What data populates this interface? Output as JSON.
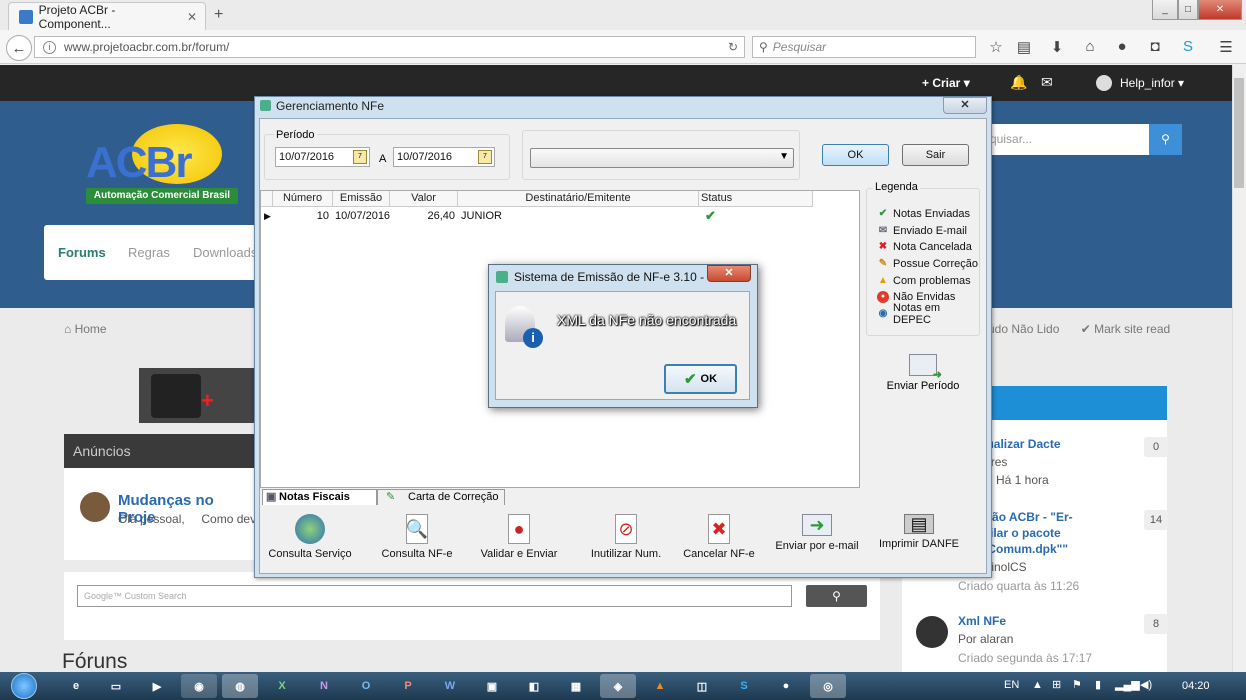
{
  "browser": {
    "tab_title": "Projeto ACBr - Component...",
    "new_tab": "+",
    "url": "www.projetoacbr.com.br/forum/",
    "search_placeholder": "Pesquisar",
    "window_controls": [
      "_",
      "□",
      "✕"
    ]
  },
  "site": {
    "top_nav": {
      "criar": "+ Criar ▾",
      "user": "Help_infor ▾"
    },
    "logo_text": "ACBr",
    "logo_subtitle": "Automação Comercial Brasil",
    "nav": [
      "Forums",
      "Regras",
      "Downloads"
    ],
    "search_placeholder": "quisar...",
    "breadcrumb": "Home",
    "marks": [
      "údo Não Lido",
      "Mark site read"
    ],
    "announce_title": "Anúncios",
    "post": {
      "title": "Mudanças no Proje",
      "excerpt": "Olá pessoal,     Como dev"
    },
    "google_placeholder": "Google™ Custom Search",
    "foruns_heading": "Fóruns",
    "recent": [
      {
        "title": "o Visualizar Dacte",
        "meta": "gosoares",
        "date": "Há 1 hora",
        "count": "0"
      },
      {
        "title": "stalação ACBr - \"Er-",
        "title2": "compilar o pacote",
        "title3": "_DFeComum.dpk\"\"",
        "meta": "umercinolCS",
        "date": "Criado quarta às 11:26",
        "count": "14"
      },
      {
        "title": "Xml NFe",
        "meta": "Por alaran",
        "date": "Criado segunda às 17:17",
        "count": "8"
      }
    ]
  },
  "dialog": {
    "title": "Gerenciamento NFe",
    "close": "✕",
    "period_label": "Período",
    "date_from": "10/07/2016",
    "date_sep": "A",
    "date_to": "10/07/2016",
    "ok_label": "OK",
    "exit_label": "Sair",
    "grid": {
      "columns": [
        "Número",
        "Emissão",
        "Valor",
        "Destinatário/Emitente",
        "Status"
      ],
      "rows": [
        {
          "numero": "10",
          "emissao": "10/07/2016",
          "valor": "26,40",
          "destinatario": "JUNIOR"
        }
      ]
    },
    "legend": {
      "title": "Legenda",
      "items": [
        "Notas Enviadas",
        "Enviado E-mail",
        "Nota Cancelada",
        "Possue Correção",
        "Com problemas",
        "Não Envidas",
        "Notas em DEPEC"
      ]
    },
    "send_period": "Enviar Período",
    "tabs": [
      "Notas Fiscais",
      "Carta de Correção"
    ],
    "toolbar": [
      "Consulta Serviço",
      "Consulta NF-e",
      "Validar e Enviar",
      "Inutilizar Num.",
      "Cancelar NF-e",
      "Enviar por e-mail",
      "Imprimir DANFE"
    ]
  },
  "message": {
    "title": "Sistema de Emissão de NF-e 3.10 - Ve...",
    "text": "XML da NFe não encontrada",
    "ok": "OK"
  },
  "taskbar": {
    "lang": "EN",
    "time": "04:20"
  }
}
